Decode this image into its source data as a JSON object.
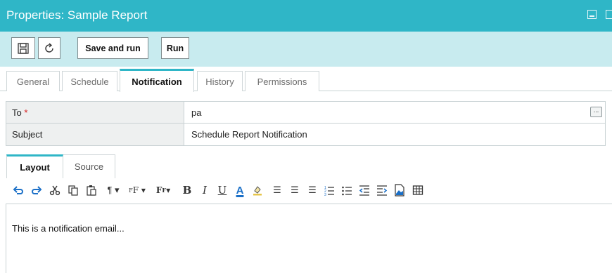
{
  "window": {
    "title": "Properties: Sample Report"
  },
  "toolbar": {
    "save_and_run_label": "Save and run",
    "run_label": "Run"
  },
  "tabs": [
    {
      "label": "General"
    },
    {
      "label": "Schedule"
    },
    {
      "label": "Notification"
    },
    {
      "label": "History"
    },
    {
      "label": "Permissions"
    }
  ],
  "form": {
    "to": {
      "label": "To",
      "required_mark": "*",
      "value": "pa",
      "browse_label": "..."
    },
    "subject": {
      "label": "Subject",
      "value": "Schedule Report Notification"
    }
  },
  "editor": {
    "tabs": [
      {
        "label": "Layout"
      },
      {
        "label": "Source"
      }
    ],
    "body_text": "This is a notification email...",
    "toolbar_icons": [
      "undo-icon",
      "redo-icon",
      "cut-icon",
      "copy-icon",
      "paste-icon",
      "paragraph-format-icon",
      "font-name-icon",
      "font-size-icon",
      "bold-icon",
      "italic-icon",
      "underline-icon",
      "font-color-icon",
      "highlight-color-icon",
      "align-left-icon",
      "align-center-icon",
      "align-right-icon",
      "numbered-list-icon",
      "bulleted-list-icon",
      "outdent-icon",
      "indent-icon",
      "insert-image-icon",
      "insert-table-icon"
    ]
  },
  "colors": {
    "titlebar": "#2fb6c7",
    "toolbar": "#c8ebef",
    "accent": "#2fb6c7",
    "undo": "#1a6fc7",
    "font_color": "#1a6fc7"
  }
}
